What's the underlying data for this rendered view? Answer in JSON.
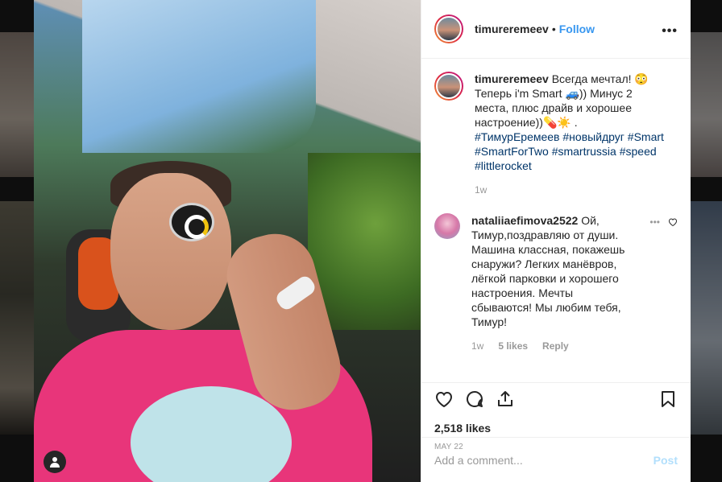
{
  "post": {
    "username": "timureremeev",
    "follow_label": "Follow",
    "dot": "•",
    "more": "•••",
    "caption_text": "Всегда мечтал! 😳 Теперь i'm Smart 🚙)) Минус 2 места, плюс драйв и хорошее настроение))💊☀️ .",
    "caption_tags": "#ТимурЕремеев #новыйдруг #Smart #SmartForTwo #smartrussia #speed #littlerocket",
    "caption_time": "1w",
    "likes": "2,518 likes",
    "date": "MAY 22"
  },
  "comment": {
    "username": "nataliiaefimova2522",
    "text": "Ой, Тимур,поздравляю от души. Машина классная, покажешь снаружи? Легких манёвров, лёгкой парковки и хорошего настроения. Мечты сбываются! Мы любим тебя, Тимур!",
    "time": "1w",
    "likes": "5 likes",
    "reply": "Reply",
    "more": "•••"
  },
  "composer": {
    "placeholder": "Add a comment...",
    "post_label": "Post"
  },
  "colors": {
    "accent": "#3897f0",
    "hashtag": "#003569",
    "post_disabled": "#b2dffc"
  },
  "icons": [
    "user-tag-icon",
    "more-icon",
    "heart-icon",
    "comment-icon",
    "share-icon",
    "bookmark-icon"
  ]
}
